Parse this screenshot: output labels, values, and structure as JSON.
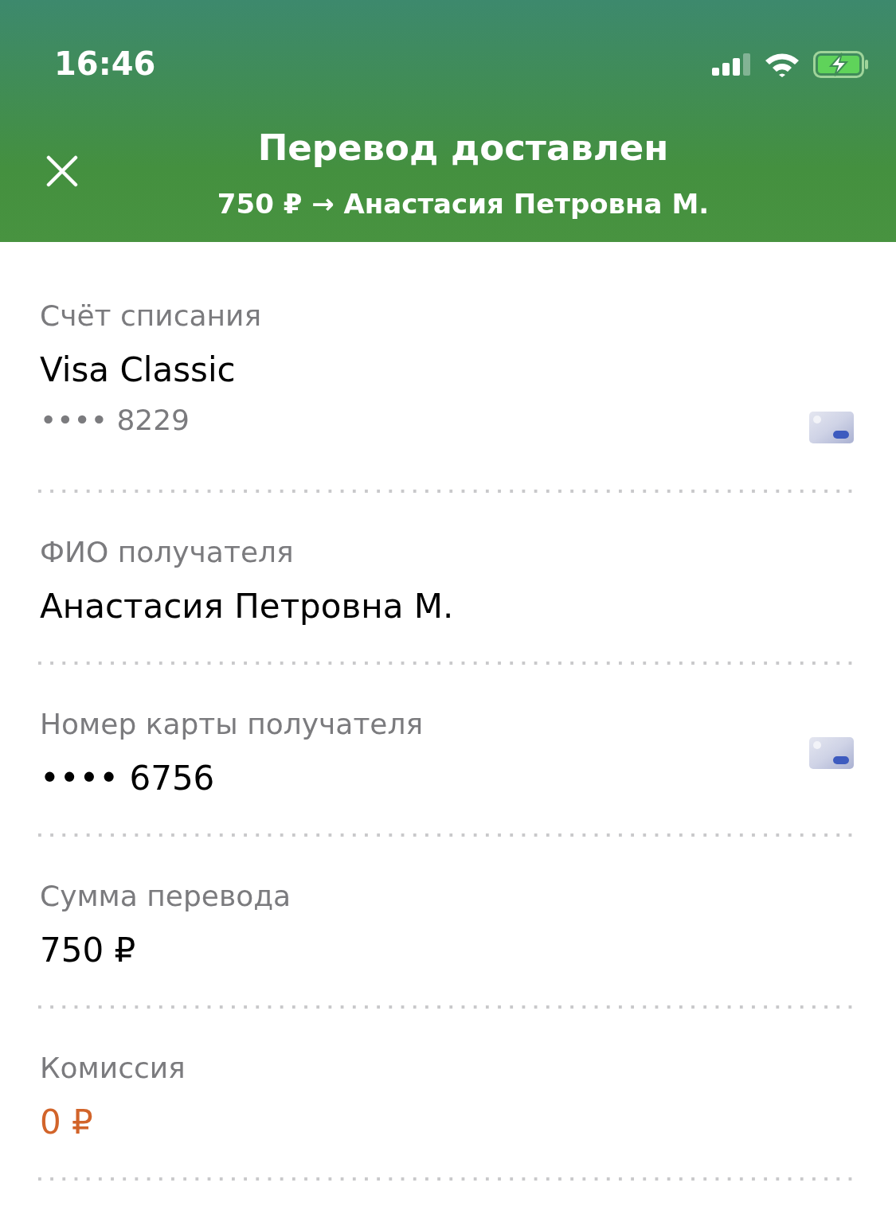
{
  "status_bar": {
    "time": "16:46"
  },
  "header": {
    "title": "Перевод доставлен",
    "subtitle": "750 ₽ → Анастасия Петровна М."
  },
  "rows": [
    {
      "kind": "card",
      "label": "Счёт списания",
      "value": "Visa Classic",
      "detail": "•••• 8229",
      "highlighted": false
    },
    {
      "kind": "plain",
      "label": "ФИО получателя",
      "value": "Анастасия Петровна М.",
      "highlighted": false
    },
    {
      "kind": "card",
      "label": "Номер карты получателя",
      "value": "•••• 6756",
      "highlighted": false
    },
    {
      "kind": "plain",
      "label": "Сумма перевода",
      "value": "750 ₽",
      "highlighted": false
    },
    {
      "kind": "plain",
      "label": "Комиссия",
      "value": "0 ₽",
      "highlighted": true
    }
  ]
}
